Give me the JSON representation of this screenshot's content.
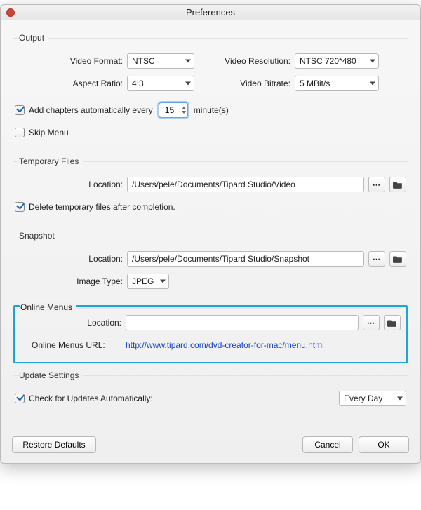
{
  "window": {
    "title": "Preferences"
  },
  "output": {
    "legend": "Output",
    "video_format_label": "Video Format:",
    "video_format_value": "NTSC",
    "aspect_ratio_label": "Aspect Ratio:",
    "aspect_ratio_value": "4:3",
    "video_resolution_label": "Video Resolution:",
    "video_resolution_value": "NTSC 720*480",
    "video_bitrate_label": "Video Bitrate:",
    "video_bitrate_value": "5 MBit/s",
    "add_chapters_label": "Add chapters automatically every",
    "add_chapters_value": "15",
    "add_chapters_suffix": "minute(s)",
    "skip_menu_label": "Skip Menu"
  },
  "temp": {
    "legend": "Temporary Files",
    "location_label": "Location:",
    "location_value": "/Users/pele/Documents/Tipard Studio/Video",
    "browse_btn_aria": "Browse",
    "open_btn_aria": "Open Folder",
    "delete_after_label": "Delete temporary files after completion."
  },
  "snapshot": {
    "legend": "Snapshot",
    "location_label": "Location:",
    "location_value": "/Users/pele/Documents/Tipard Studio/Snapshot",
    "image_type_label": "Image Type:",
    "image_type_value": "JPEG"
  },
  "online_menus": {
    "legend": "Online Menus",
    "location_label": "Location:",
    "location_value": "",
    "url_label": "Online Menus URL:",
    "url_value": "http://www.tipard.com/dvd-creator-for-mac/menu.html"
  },
  "update": {
    "legend": "Update Settings",
    "check_label": "Check for Updates Automatically:",
    "interval_value": "Every Day"
  },
  "footer": {
    "restore": "Restore Defaults",
    "cancel": "Cancel",
    "ok": "OK"
  }
}
